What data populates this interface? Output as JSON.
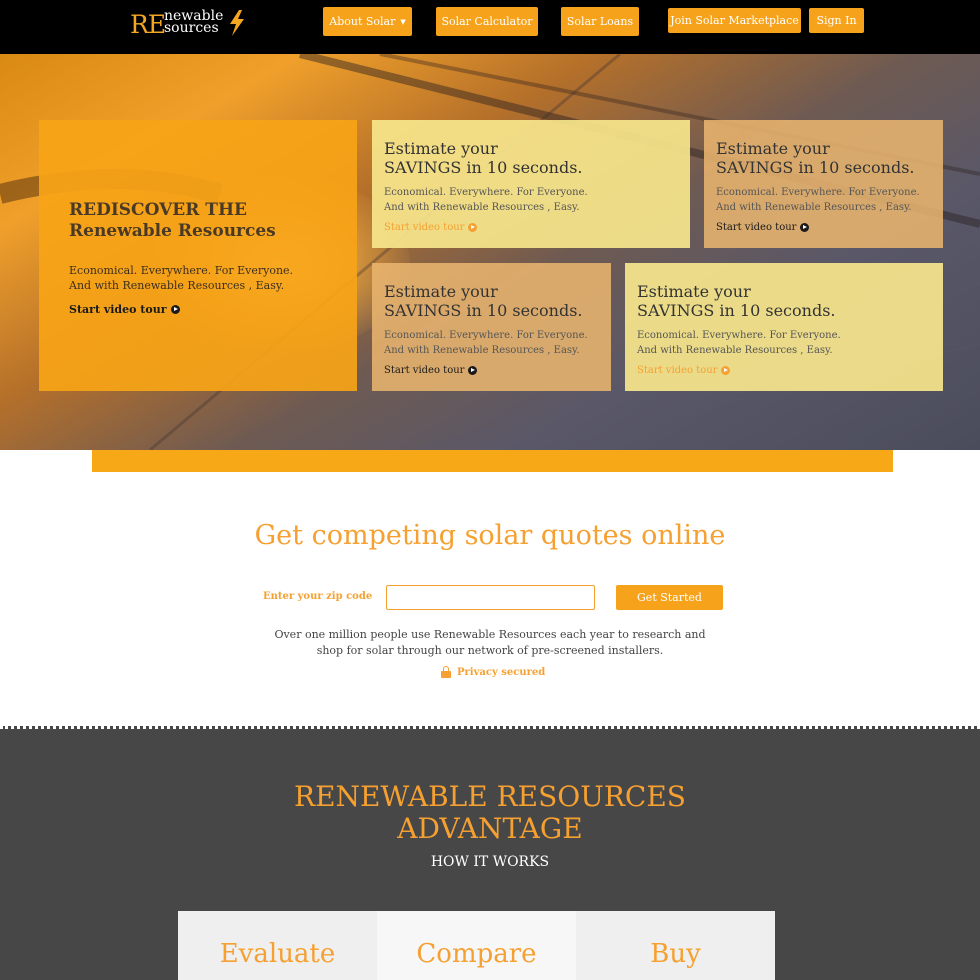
{
  "brand": {
    "logo_prefix": "RE",
    "logo_line1": "newable",
    "logo_line2": "sources",
    "accent_color": "#f7a21b",
    "bolt_icon": "lightning-bolt-icon"
  },
  "nav": {
    "items": [
      {
        "label": "About Solar",
        "has_dropdown": true
      },
      {
        "label": "Solar Calculator"
      },
      {
        "label": "Solar Loans"
      },
      {
        "label": "Join Solar Marketplace"
      },
      {
        "label": "Sign In"
      }
    ],
    "dropdown_icon": "caret-down-icon"
  },
  "hero": {
    "main": {
      "title_line1": "REDISCOVER THE",
      "title_line2": "Renewable Resources",
      "sub_line1": "Economical. Everywhere. For Everyone.",
      "sub_line2": "And with Renewable Resources , Easy.",
      "link": "Start video tour"
    },
    "cards": [
      {
        "title_line1": "Estimate your",
        "title_line2": "SAVINGS in 10 seconds.",
        "desc_line1": "Economical. Everywhere. For Everyone.",
        "desc_line2": "And with Renewable Resources , Easy.",
        "link": "Start video tour",
        "link_color": "#f5a030"
      },
      {
        "title_line1": "Estimate your",
        "title_line2": "SAVINGS in 10 seconds.",
        "desc_line1": "Economical. Everywhere. For Everyone.",
        "desc_line2": "And with Renewable Resources , Easy.",
        "link": "Start video tour",
        "link_color": "#1a1a1a"
      },
      {
        "title_line1": "Estimate your",
        "title_line2": "SAVINGS in 10 seconds.",
        "desc_line1": "Economical. Everywhere. For Everyone.",
        "desc_line2": "And with Renewable Resources , Easy.",
        "link": "Start video tour",
        "link_color": "#1a1a1a"
      },
      {
        "title_line1": "Estimate your",
        "title_line2": "SAVINGS in 10 seconds.",
        "desc_line1": "Economical. Everywhere. For Everyone.",
        "desc_line2": "And with Renewable Resources , Easy.",
        "link": "Start video tour",
        "link_color": "#f5a030"
      }
    ],
    "play_icon": "play-circle-icon"
  },
  "quote": {
    "title": "Get competing solar quotes online",
    "zip_label": "Enter your zip code",
    "zip_value": "",
    "zip_placeholder": "",
    "button": "Get Started",
    "desc_line1": "Over one million people use Renewable Resources each year to research and",
    "desc_line2": "shop for solar through our network of pre-screened installers.",
    "privacy": "Privacy secured",
    "privacy_icon": "lock-icon"
  },
  "advantage": {
    "title_line1": "RENEWABLE RESOURCES",
    "title_line2": "ADVANTAGE",
    "subtitle": "HOW IT WORKS",
    "steps": [
      {
        "label": "Evaluate",
        "bg": "#efefef"
      },
      {
        "label": "Compare",
        "bg": "#f7f7f7"
      },
      {
        "label": "Buy",
        "bg": "#efefef"
      }
    ]
  }
}
